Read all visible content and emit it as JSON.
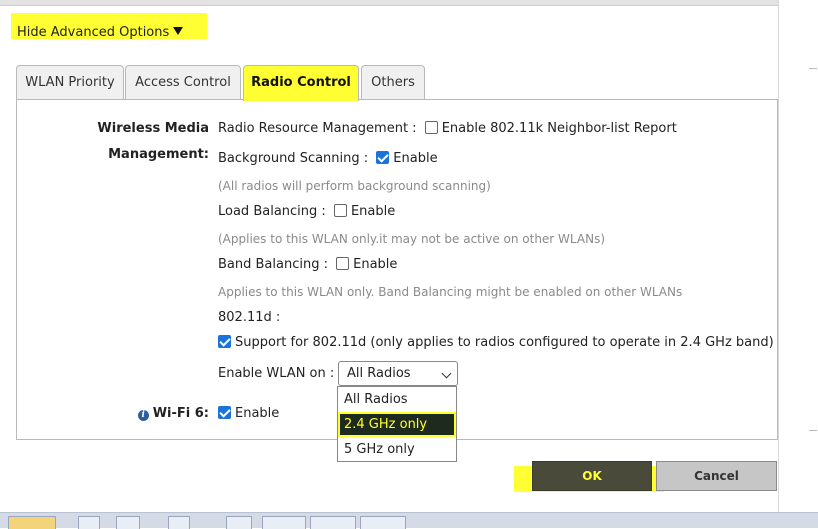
{
  "advanced": {
    "label": "Hide Advanced Options"
  },
  "tabs": [
    {
      "label": "WLAN Priority"
    },
    {
      "label": "Access Control"
    },
    {
      "label": "Radio Control"
    },
    {
      "label": "Others"
    }
  ],
  "wmm": {
    "section_label_1": "Wireless Media",
    "section_label_2": "Management:",
    "rrm_label": "Radio Resource Management :",
    "rrm_option": "Enable 802.11k Neighbor-list Report",
    "bg_scan_label": "Background Scanning :",
    "bg_scan_option": "Enable",
    "bg_scan_note": "(All radios will perform background scanning)",
    "load_bal_label": "Load Balancing :",
    "load_bal_option": "Enable",
    "load_bal_note": "(Applies to this WLAN only.it may not be active on other WLANs)",
    "band_bal_label": "Band Balancing :",
    "band_bal_option": "Enable",
    "band_bal_note": "Applies to this WLAN only. Band Balancing might be enabled on other WLANs",
    "d_label": "802.11d :",
    "d_option": "Support for 802.11d (only applies to radios configured to operate in 2.4 GHz band)",
    "enable_on_label": "Enable WLAN on :",
    "enable_on_value": "All Radios",
    "options": [
      "All Radios",
      "2.4 GHz only",
      "5 GHz only"
    ]
  },
  "wifi6": {
    "label": "Wi-Fi 6:",
    "option": "Enable"
  },
  "buttons": {
    "ok": "OK",
    "cancel": "Cancel"
  },
  "colors": {
    "highlight": "#ffff33",
    "checkbox": "#1a73d9"
  }
}
